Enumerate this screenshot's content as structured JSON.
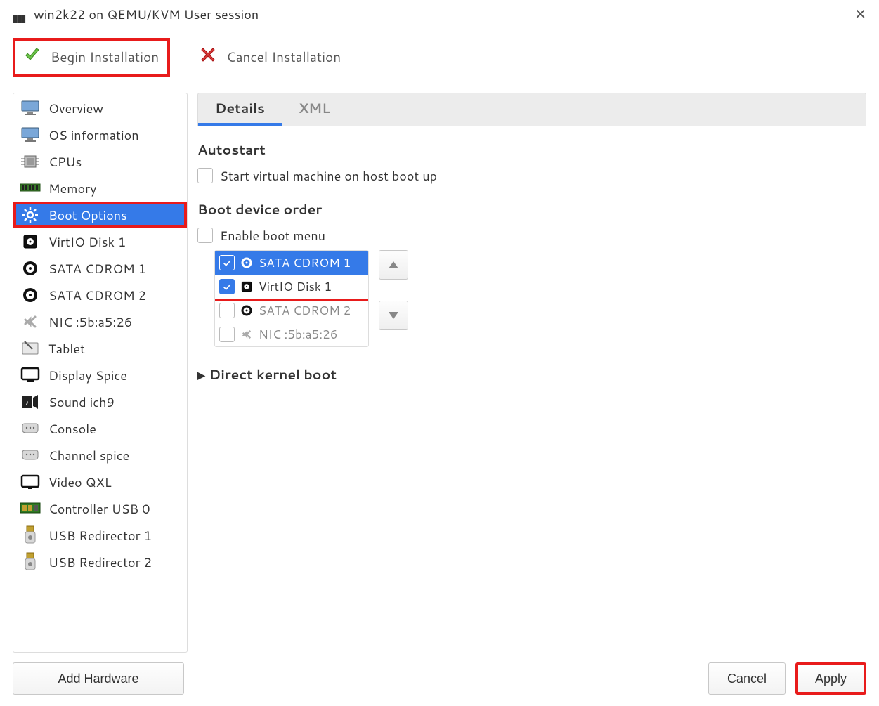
{
  "titlebar": {
    "text": "win2k22 on QEMU/KVM User session"
  },
  "toolbar": {
    "begin_label": "Begin Installation",
    "cancel_label": "Cancel Installation"
  },
  "sidebar": {
    "items": [
      {
        "label": "Overview",
        "icon": "monitor"
      },
      {
        "label": "OS information",
        "icon": "monitor"
      },
      {
        "label": "CPUs",
        "icon": "cpu"
      },
      {
        "label": "Memory",
        "icon": "ram"
      },
      {
        "label": "Boot Options",
        "icon": "gear",
        "selected": true
      },
      {
        "label": "VirtIO Disk 1",
        "icon": "blockdisk"
      },
      {
        "label": "SATA CDROM 1",
        "icon": "cd"
      },
      {
        "label": "SATA CDROM 2",
        "icon": "cd"
      },
      {
        "label": "NIC :5b:a5:26",
        "icon": "nic"
      },
      {
        "label": "Tablet",
        "icon": "tablet"
      },
      {
        "label": "Display Spice",
        "icon": "display"
      },
      {
        "label": "Sound ich9",
        "icon": "sound"
      },
      {
        "label": "Console",
        "icon": "serial"
      },
      {
        "label": "Channel spice",
        "icon": "serial"
      },
      {
        "label": "Video QXL",
        "icon": "video"
      },
      {
        "label": "Controller USB 0",
        "icon": "usbctl"
      },
      {
        "label": "USB Redirector 1",
        "icon": "usb"
      },
      {
        "label": "USB Redirector 2",
        "icon": "usb"
      }
    ],
    "add_hw_label": "Add Hardware"
  },
  "tabs": {
    "details": "Details",
    "xml": "XML"
  },
  "boot": {
    "autostart_title": "Autostart",
    "autostart_cb_label": "Start virtual machine on host boot up",
    "autostart_checked": false,
    "order_title": "Boot device order",
    "enable_menu_label": "Enable boot menu",
    "enable_menu_checked": false,
    "devices": [
      {
        "label": "SATA CDROM 1",
        "checked": true,
        "selected": true,
        "icon": "cd"
      },
      {
        "label": "VirtIO Disk 1",
        "checked": true,
        "selected": false,
        "icon": "blockdisk"
      },
      {
        "label": "SATA CDROM 2",
        "checked": false,
        "selected": false,
        "icon": "cd",
        "disabled": true
      },
      {
        "label": "NIC :5b:a5:26",
        "checked": false,
        "selected": false,
        "icon": "nic",
        "disabled": true
      }
    ],
    "direct_kernel_title": "Direct kernel boot"
  },
  "footer": {
    "cancel": "Cancel",
    "apply": "Apply"
  }
}
